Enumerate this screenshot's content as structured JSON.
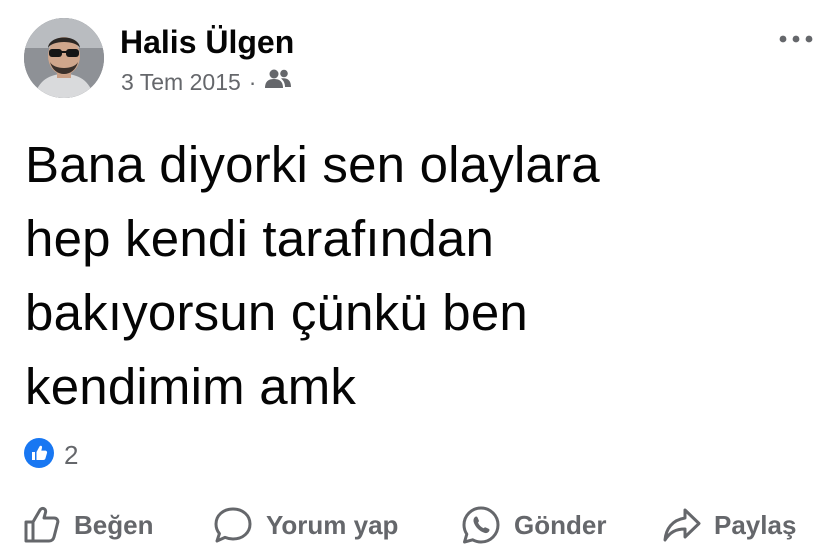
{
  "post": {
    "author_name": "Halis Ülgen",
    "date": "3 Tem 2015",
    "separator": "·",
    "audience_icon": "friends-icon",
    "more_icon": "more-options-icon",
    "text": "Bana diyorki sen olaylara\nhep kendi tarafından\nbakıyorsun çünkü ben\nkendimim amk"
  },
  "reactions": {
    "icon": "like-reaction-icon",
    "color": "#1877f2",
    "count": "2"
  },
  "actions": {
    "like_label": "Beğen",
    "comment_label": "Yorum yap",
    "send_label": "Gönder",
    "share_label": "Paylaş"
  }
}
